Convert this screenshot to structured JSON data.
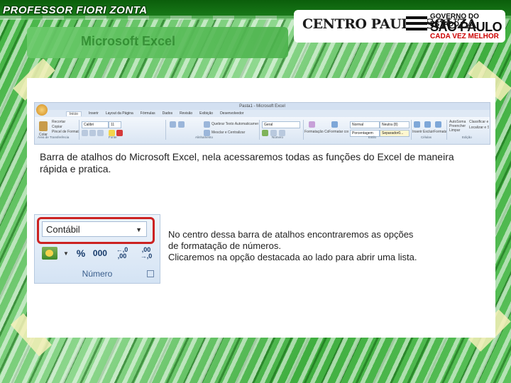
{
  "header": {
    "brand": "PROFESSOR FIORI ZONTA",
    "logo_cps": "CENTRO PAULA SOUZA",
    "logo_gov": "GOVERNO DO ESTADO",
    "logo_sp": "SÃO PAULO",
    "logo_slogan": "CADA VEZ MELHOR"
  },
  "slide": {
    "title": "Microsoft Excel"
  },
  "ribbon": {
    "window_title": "Pasta1 - Microsoft Excel",
    "tabs": [
      "Início",
      "Inserir",
      "Layout da Página",
      "Fórmulas",
      "Dados",
      "Revisão",
      "Exibição",
      "Desenvolvedor"
    ],
    "fields": {
      "font": "Calibri",
      "size": "11",
      "format_general": "Geral",
      "normal": "Normal",
      "neutral": "Neutra (8)",
      "percent": "Porcentagem",
      "separator": "Separador0..."
    },
    "groups": [
      "Área de Transferência",
      "Fonte",
      "Alinhamento",
      "Número",
      "Estilo",
      "Células",
      "Edição"
    ],
    "buttons": [
      "Colar",
      "Recortar",
      "Copiar",
      "Pincel de Formatação",
      "Quebrar Texto Automaticamente",
      "Mesclar e Centralizar",
      "Formatação Condicional",
      "Formatar como Tabela",
      "Inserir",
      "Excluir",
      "Formatar",
      "AutoSoma",
      "Preencher",
      "Limpar",
      "Classificar e Filtrar",
      "Localizar e Selecionar"
    ]
  },
  "caption_top": "Barra de atalhos do Microsoft Excel, nela acessaremos todas as funções do Excel de maneira rápida e pratica.",
  "number_panel": {
    "select_value": "Contábil",
    "percent": "%",
    "thousands": "000",
    "inc_decimal": "←,0 ,00",
    "dec_decimal": ",00 →,0",
    "group_label": "Número"
  },
  "caption_right": [
    "No centro dessa barra de atalhos encontraremos as opções",
    "de formatação de números.",
    "Clicaremos na opção destacada ao lado para abrir uma lista."
  ],
  "colors": {
    "accent_green": "#2f9c2f",
    "highlight_red": "#cc2222",
    "ribbon_blue": "#dfe9f5"
  }
}
